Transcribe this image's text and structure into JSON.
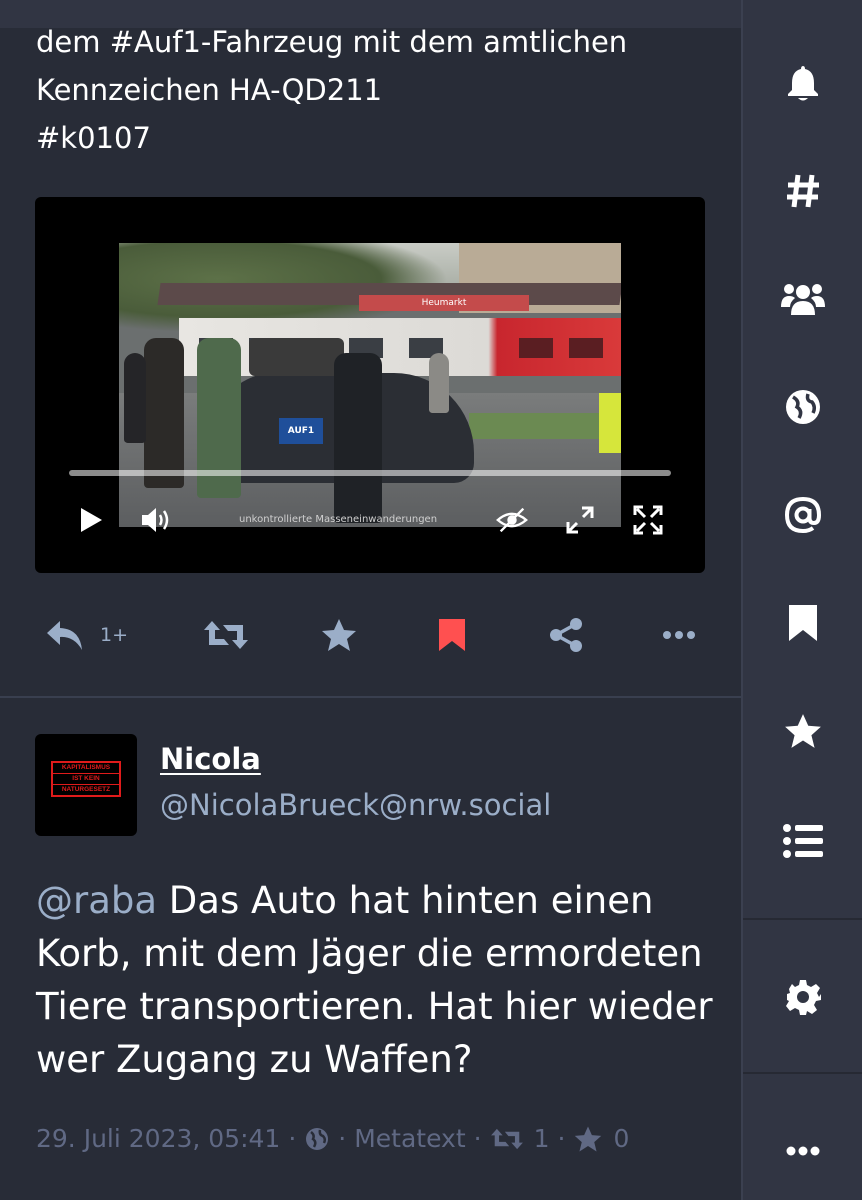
{
  "post1": {
    "text_lines": [
      "dem #Auf1-Fahrzeug mit dem amtlichen",
      "Kennzeichen HA-QD211",
      "#k0107"
    ],
    "video": {
      "sign_text": "Heumarkt",
      "logo_text": "AUF1",
      "caption": "unkontrollierte Masseneinwanderungen",
      "progress": 0
    },
    "actions": {
      "reply_count": "1+"
    }
  },
  "post2": {
    "avatar_lines": [
      "KAPITALISMUS",
      "IST KEIN",
      "NATURGESETZ"
    ],
    "display_name": "Nicola",
    "account": "@NicolaBrueck@nrw.social",
    "mention": "@raba",
    "content_lines": [
      " Das Auto hat hinten einen",
      "Korb, mit dem Jäger die ermordeten",
      "Tiere transportieren. Hat hier wieder",
      "wer Zugang zu Waffen?"
    ],
    "meta": {
      "date": "29. Juli 2023, 05:41",
      "separator": "·",
      "app": "Metatext",
      "boosts": "1",
      "favourites": "0"
    }
  },
  "nav": {
    "items": [
      "bell-icon",
      "hashtag-icon",
      "users-icon",
      "globe-icon",
      "at-icon",
      "bookmark-icon",
      "star-icon",
      "list-icon",
      "gear-icon",
      "more-icon"
    ]
  },
  "colors": {
    "background": "#282c37",
    "sidebar": "#313543",
    "muted_text": "#9baec8",
    "meta_text": "#606984",
    "bookmark_active": "#ff5050"
  }
}
